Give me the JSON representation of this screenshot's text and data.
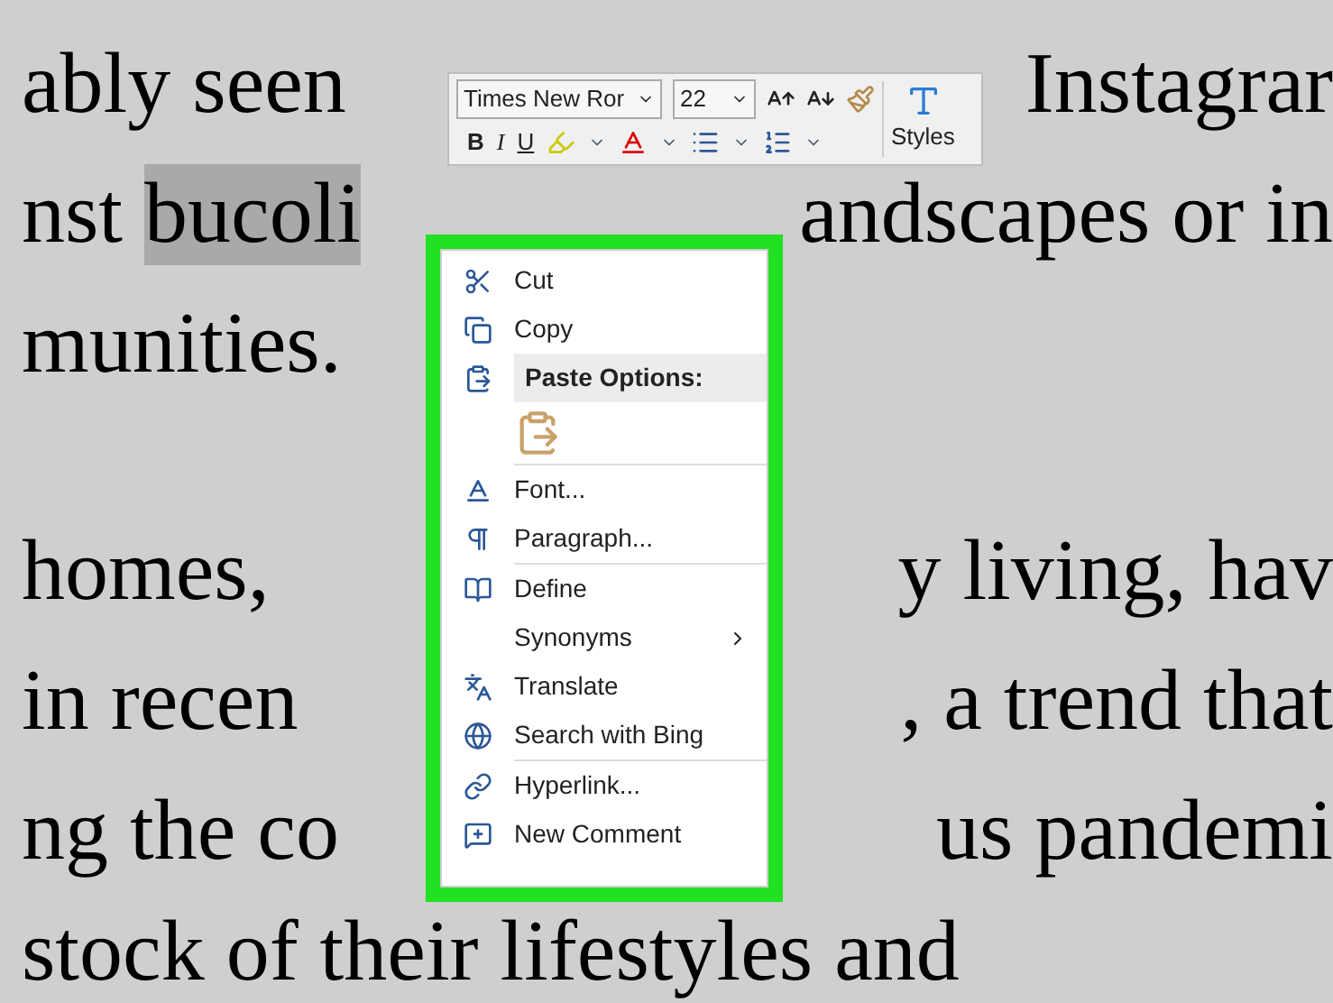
{
  "document": {
    "lines": [
      {
        "left": "ably seen",
        "right": "Instagrar"
      },
      {
        "left": "nst ",
        "highlighted": "bucoli",
        "right": "andscapes or in"
      },
      {
        "left": "munities.",
        "paragraph_end": true
      },
      {
        "left": "homes,",
        "right": "y living, hav"
      },
      {
        "left": "in recen",
        "right": ", a trend that"
      },
      {
        "left": "ng the co",
        "right": "us pandemi"
      },
      {
        "left": "stock of their lifestyles and"
      }
    ]
  },
  "mini_toolbar": {
    "font": "Times New Ror",
    "size": "22",
    "bold": "B",
    "italic": "I",
    "underline": "U",
    "styles": "Styles"
  },
  "context_menu": {
    "groups": [
      [
        {
          "kind": "cut",
          "label": "Cut"
        },
        {
          "kind": "copy",
          "label": "Copy"
        },
        {
          "kind": "header",
          "label": "Paste Options:"
        },
        {
          "kind": "paste"
        }
      ],
      [
        {
          "kind": "font",
          "label": "Font..."
        },
        {
          "kind": "paragraph",
          "label": "Paragraph..."
        }
      ],
      [
        {
          "kind": "define",
          "label": "Define"
        },
        {
          "kind": "plain",
          "label": "Synonyms",
          "submenu": true
        },
        {
          "kind": "translate",
          "label": "Translate"
        },
        {
          "kind": "search",
          "label": "Search with Bing"
        }
      ],
      [
        {
          "kind": "hyperlink",
          "label": "Hyperlink..."
        },
        {
          "kind": "comment",
          "label": "New Comment"
        }
      ]
    ]
  }
}
